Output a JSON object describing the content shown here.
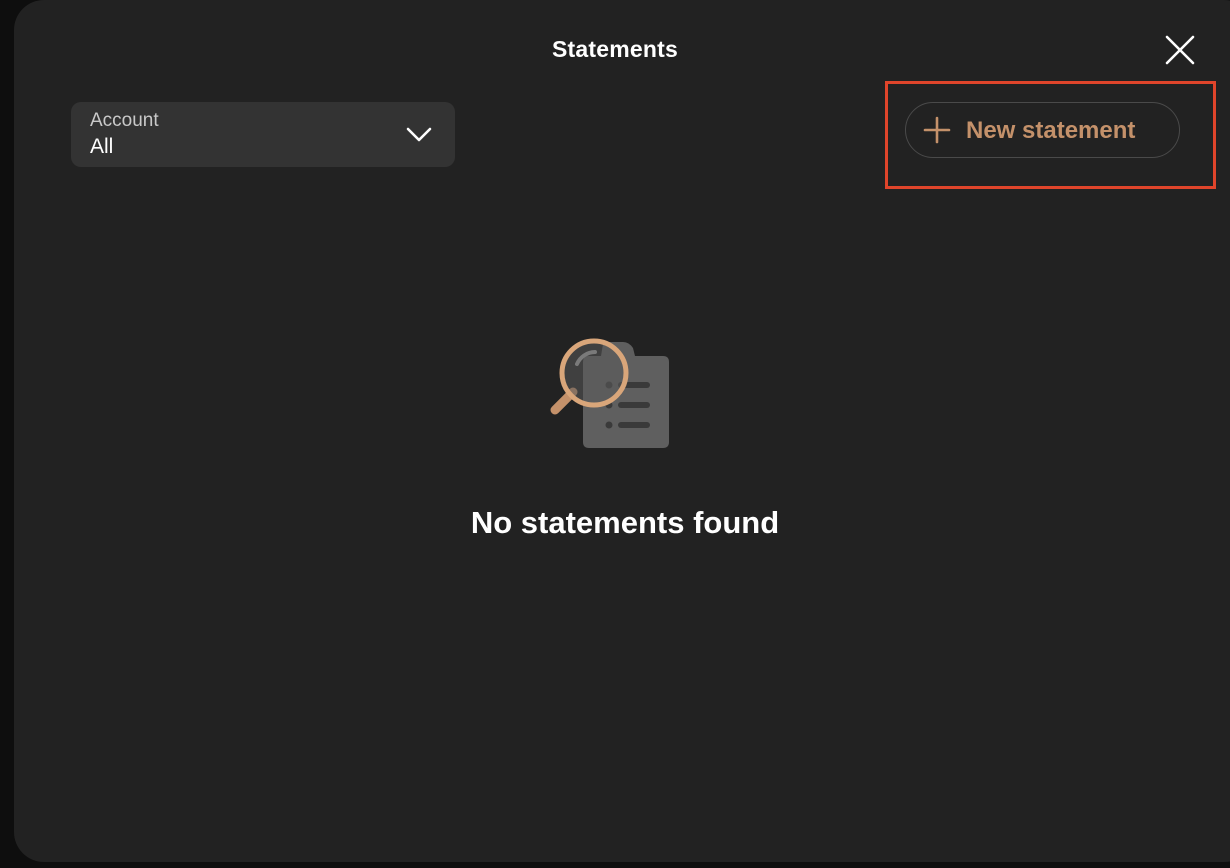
{
  "modal": {
    "title": "Statements",
    "close_icon": "close-icon"
  },
  "filter": {
    "label": "Account",
    "value": "All",
    "icon": "chevron-down-icon"
  },
  "actions": {
    "new_statement_label": "New statement",
    "icon": "plus-icon"
  },
  "empty_state": {
    "message": "No statements found",
    "icon": "document-search-icon"
  },
  "colors": {
    "background": "#222222",
    "accent": "#c4916a",
    "highlight": "#e0452b",
    "select_bg": "#333333"
  }
}
